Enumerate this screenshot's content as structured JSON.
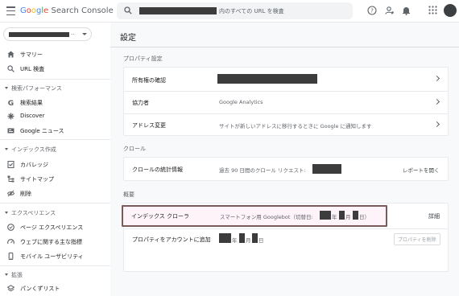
{
  "header": {
    "logo_google": "Google",
    "logo_product": "Search Console",
    "search_placeholder": "内のすべての URL を検査",
    "icons": [
      "menu-icon",
      "search-icon",
      "help-icon",
      "manage-accounts-icon",
      "bell-icon",
      "apps-grid-icon",
      "avatar"
    ]
  },
  "sidebar": {
    "property_suffix": "..",
    "items_top": [
      {
        "label": "サマリー",
        "icon": "home-icon"
      },
      {
        "label": "URL 検査",
        "icon": "search-icon"
      }
    ],
    "sections": [
      {
        "title": "検索パフォーマンス",
        "items": [
          {
            "label": "検索結果",
            "icon": "google-g-icon"
          },
          {
            "label": "Discover",
            "icon": "asterisk-icon"
          },
          {
            "label": "Google ニュース",
            "icon": "news-icon"
          }
        ]
      },
      {
        "title": "インデックス作成",
        "items": [
          {
            "label": "カバレッジ",
            "icon": "coverage-icon"
          },
          {
            "label": "サイトマップ",
            "icon": "sitemap-icon"
          },
          {
            "label": "削除",
            "icon": "eye-off-icon"
          }
        ]
      },
      {
        "title": "エクスペリエンス",
        "items": [
          {
            "label": "ページ エクスペリエンス",
            "icon": "page-experience-icon"
          },
          {
            "label": "ウェブに関する主な指標",
            "icon": "gauge-icon"
          },
          {
            "label": "モバイル ユーザビリティ",
            "icon": "phone-icon"
          }
        ]
      },
      {
        "title": "拡張",
        "items": [
          {
            "label": "パンくずリスト",
            "icon": "layers-icon"
          }
        ]
      }
    ]
  },
  "main": {
    "page_title": "設定",
    "property_settings": {
      "label": "プロパティ設定",
      "rows": [
        {
          "label": "所有権の確認",
          "value": ""
        },
        {
          "label": "協力者",
          "value": "Google Analytics"
        },
        {
          "label": "アドレス変更",
          "value": "サイトが新しいアドレスに移行するときに Google に通知します"
        }
      ]
    },
    "crawl": {
      "label": "クロール",
      "row": {
        "label": "クロールの統計情報",
        "value": "過去 90 日間のクロール リクエスト:",
        "action": "レポートを開く"
      }
    },
    "about": {
      "label": "概要",
      "indexing_crawler": {
        "label": "インデックス クローラ",
        "value_prefix": "スマートフォン用 Googlebot（切替日:",
        "year_suffix": "年",
        "month_suffix": "月",
        "day_suffix": "日）",
        "action": "詳細"
      },
      "added": {
        "label": "プロパティをアカウントに追加",
        "year_suffix": "年",
        "month_suffix": "月",
        "day_suffix": "日",
        "action": "プロパティを削除"
      }
    }
  },
  "colors": {
    "accent": "#1a73e8",
    "highlight_border": "#7b5a5a",
    "highlight_bg": "#fff3fa",
    "redaction": "#3c3c3c"
  }
}
